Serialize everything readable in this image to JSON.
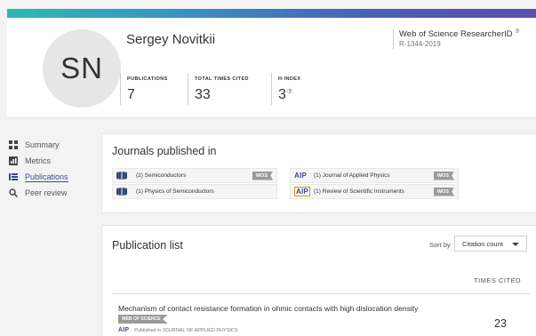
{
  "profile": {
    "initials": "SN",
    "name": "Sergey Novitkii",
    "researcher_id_label": "Web of Science ResearcherID",
    "researcher_id": "R-1344-2019",
    "help_symbol": "⑦",
    "stats": [
      {
        "label": "PUBLICATIONS",
        "value": "7"
      },
      {
        "label": "TOTAL TIMES CITED",
        "value": "33"
      },
      {
        "label": "H-INDEX",
        "value": "3"
      }
    ]
  },
  "nav": {
    "items": [
      {
        "label": "Summary",
        "icon": "summary-grid-icon"
      },
      {
        "label": "Metrics",
        "icon": "bar-chart-icon"
      },
      {
        "label": "Publications",
        "icon": "list-icon",
        "active": true
      },
      {
        "label": "Peer review",
        "icon": "search-icon"
      }
    ]
  },
  "journals": {
    "title": "Journals published in",
    "items": [
      {
        "name": "(2) Semiconductors",
        "logo": "book-icon",
        "tag": "WOS"
      },
      {
        "name": "(1) Physics of Semiconductors",
        "logo": "book-icon",
        "tag": ""
      },
      {
        "name": "(1) Journal of Applied Physics",
        "logo": "AIP",
        "tag": "WOS"
      },
      {
        "name": "(1) Review of Scientific Instruments",
        "logo": "AIP",
        "tag": "WOS"
      }
    ]
  },
  "publications": {
    "title": "Publication list",
    "sort_label": "Sort by",
    "sort_value": "Citation count",
    "times_cited_header": "TIMES CITED",
    "items": [
      {
        "title": "Mechanism of contact resistance formation in ohmic contacts with high dislocation density",
        "badge": "WEB OF SCIENCE",
        "publisher_logo": "AIP",
        "published_in": "Published in JOURNAL OF APPLIED PHYSICS",
        "times_cited": "23"
      }
    ]
  },
  "colors": {
    "accent_nav": "#3a4a8c",
    "aip_blue": "#3b4a8a",
    "tag_gray": "#9a9a9a"
  }
}
